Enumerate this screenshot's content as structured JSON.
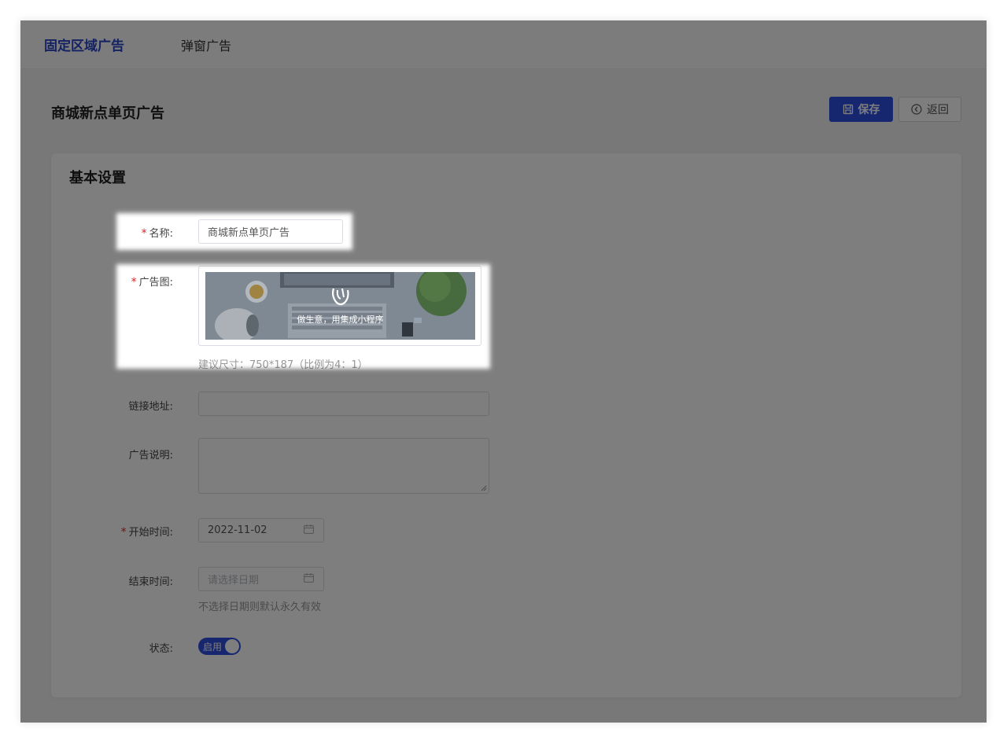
{
  "tabs": [
    {
      "label": "固定区域广告",
      "active": true
    },
    {
      "label": "弹窗广告",
      "active": false
    }
  ],
  "page": {
    "title": "商城新点单页广告"
  },
  "toolbar": {
    "save_label": "保存",
    "back_label": "返回"
  },
  "card": {
    "title": "基本设置"
  },
  "form": {
    "name": {
      "label": "名称:",
      "value": "商城新点单页广告",
      "required": true
    },
    "ad_image": {
      "label": "广告图:",
      "required": true,
      "banner_text": "做生意，用集成小程序",
      "hint": "建议尺寸：750*187（比例为4：1）"
    },
    "link": {
      "label": "链接地址:",
      "value": ""
    },
    "description": {
      "label": "广告说明:",
      "value": ""
    },
    "start_time": {
      "label": "开始时间:",
      "value": "2022-11-02",
      "required": true
    },
    "end_time": {
      "label": "结束时间:",
      "placeholder": "请选择日期",
      "hint": "不选择日期则默认永久有效"
    },
    "status": {
      "label": "状态:",
      "switch_text": "启用",
      "on": true
    }
  },
  "colors": {
    "accent": "#2d4fe0",
    "tab_active": "#2b45c6",
    "required": "#e02424"
  },
  "icons": {
    "save": "save-icon",
    "back": "back-circle-icon",
    "calendar": "calendar-icon",
    "banner_logo": "brand-logo-icon"
  }
}
